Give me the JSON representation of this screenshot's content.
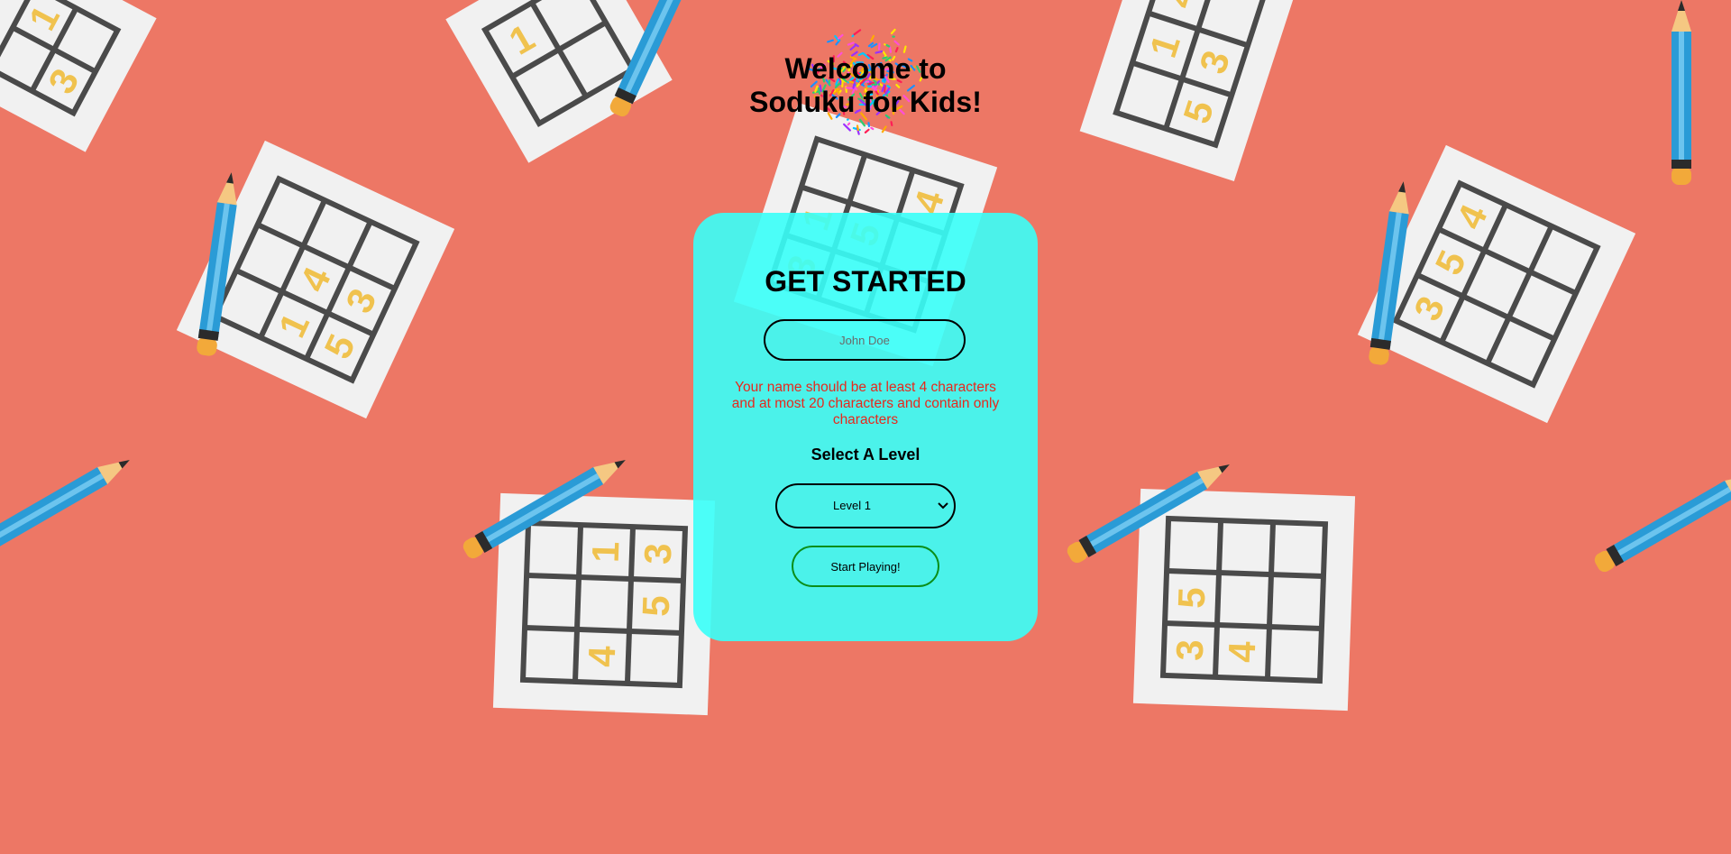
{
  "header": {
    "title_line1": "Welcome to",
    "title_line2": "Soduku for Kids!"
  },
  "form": {
    "heading": "GET STARTED",
    "name_placeholder": "John Doe",
    "name_value": "",
    "error_message": "Your name should be at least 4 characters and at most 20 characters and contain only characters",
    "level_label": "Select A Level",
    "level_selected": "Level 1",
    "start_button": "Start Playing!"
  },
  "colors": {
    "background": "#ed7765",
    "card": "#38fff8",
    "error": "#e8281c",
    "start_border": "#0b8e19"
  },
  "background_tiles": [
    {
      "digits": [
        "",
        "1",
        "3",
        ""
      ]
    },
    {
      "digits": [
        "1",
        "",
        "",
        ""
      ]
    },
    {
      "digits": [
        "",
        "1",
        "4",
        "5",
        "3",
        ""
      ]
    },
    {
      "digits": [
        "",
        "",
        "",
        "1",
        "4",
        "",
        "5",
        "3",
        ""
      ]
    },
    {
      "digits": [
        "3",
        "1",
        "",
        "",
        "5",
        "",
        "",
        "",
        "4"
      ]
    },
    {
      "digits": [
        "",
        "",
        "",
        "4",
        "",
        "1",
        "",
        "5",
        "3"
      ]
    },
    {
      "digits": [
        "3",
        "5",
        "",
        "4",
        "",
        ""
      ]
    },
    {
      "digits": [
        "3",
        "5",
        "4",
        "",
        "",
        ""
      ]
    }
  ],
  "icons": [
    "splash-icon",
    "pencil-icon",
    "sudoku-grid-icon",
    "chevron-down-icon"
  ]
}
